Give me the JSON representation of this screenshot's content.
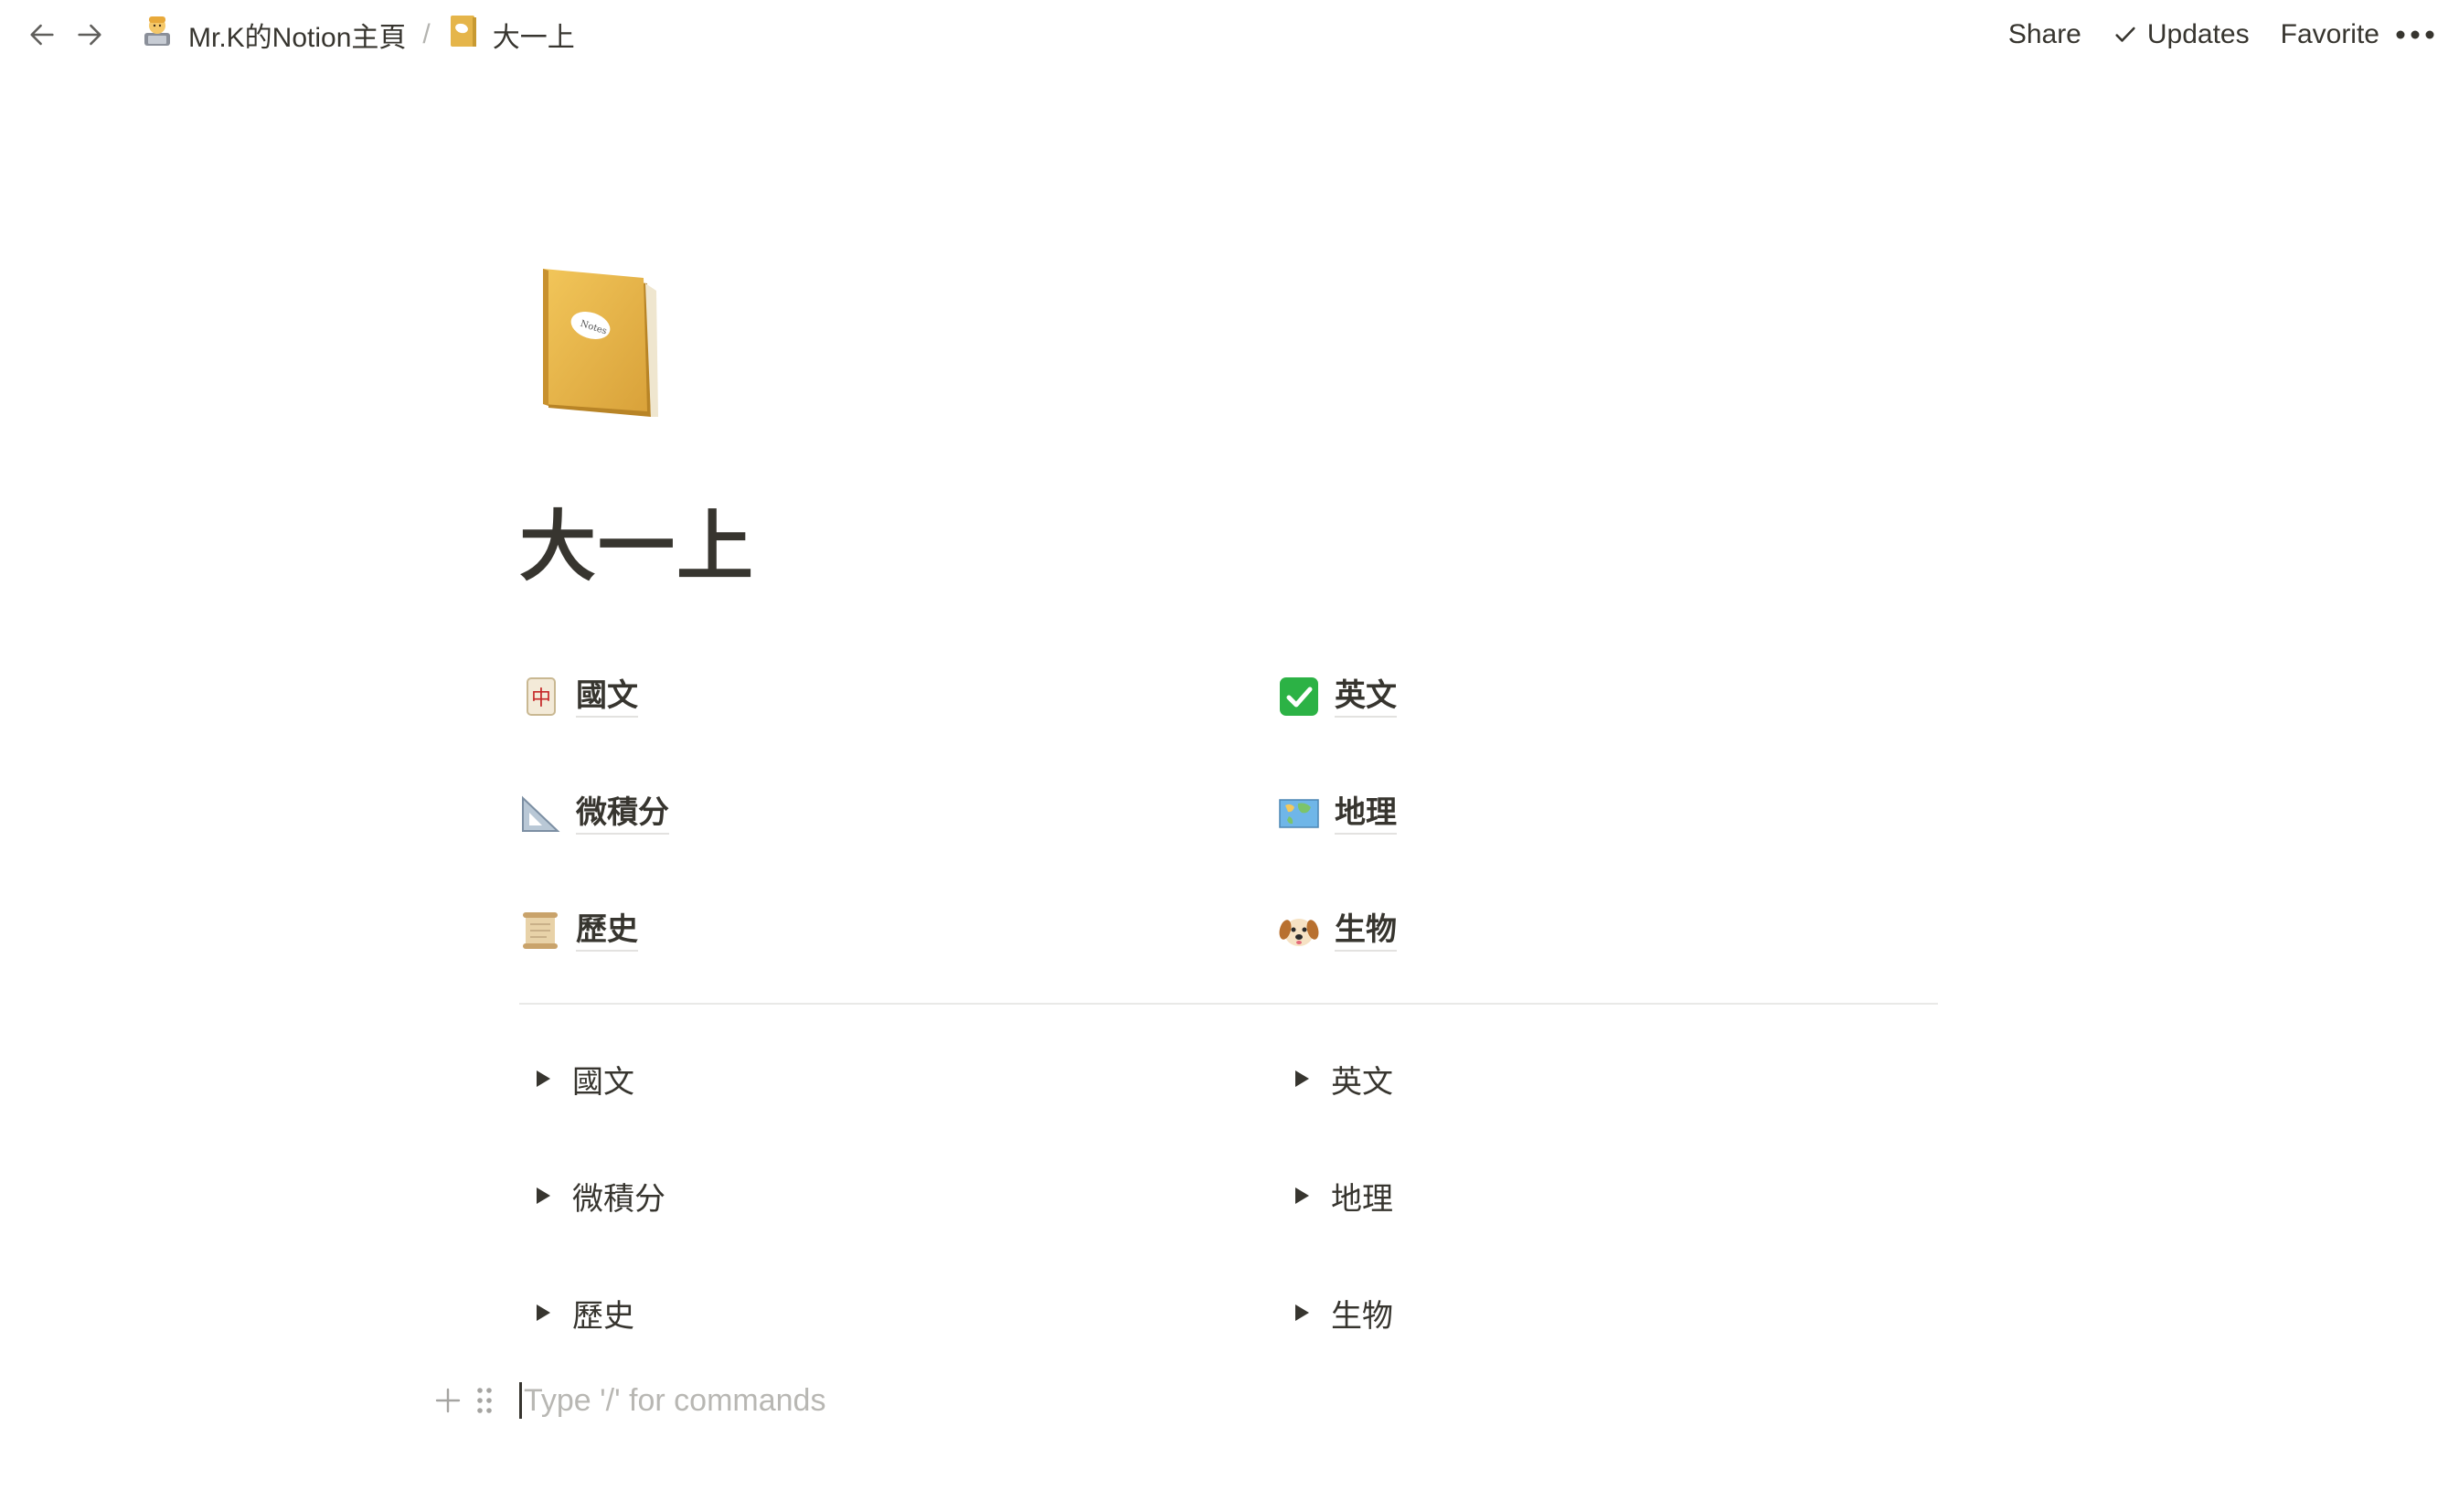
{
  "topbar": {
    "breadcrumb": [
      {
        "label": "Mr.K的Notion主頁",
        "icon": "technologist-emoji"
      },
      {
        "label": "大一上",
        "icon": "notebook-emoji"
      }
    ],
    "separator": "/",
    "actions": {
      "share": "Share",
      "updates": "Updates",
      "favorite": "Favorite"
    }
  },
  "page": {
    "icon": "notebook-emoji",
    "title": "大一上"
  },
  "links": [
    {
      "label": "國文",
      "icon": "mahjong-red-dragon-emoji"
    },
    {
      "label": "英文",
      "icon": "check-mark-button-emoji"
    },
    {
      "label": "微積分",
      "icon": "triangular-ruler-emoji"
    },
    {
      "label": "地理",
      "icon": "world-map-emoji"
    },
    {
      "label": "歷史",
      "icon": "scroll-emoji"
    },
    {
      "label": "生物",
      "icon": "dog-face-emoji"
    }
  ],
  "toggles": [
    {
      "label": "國文"
    },
    {
      "label": "英文"
    },
    {
      "label": "微積分"
    },
    {
      "label": "地理"
    },
    {
      "label": "歷史"
    },
    {
      "label": "生物"
    }
  ],
  "editor": {
    "placeholder": "Type '/' for commands"
  }
}
